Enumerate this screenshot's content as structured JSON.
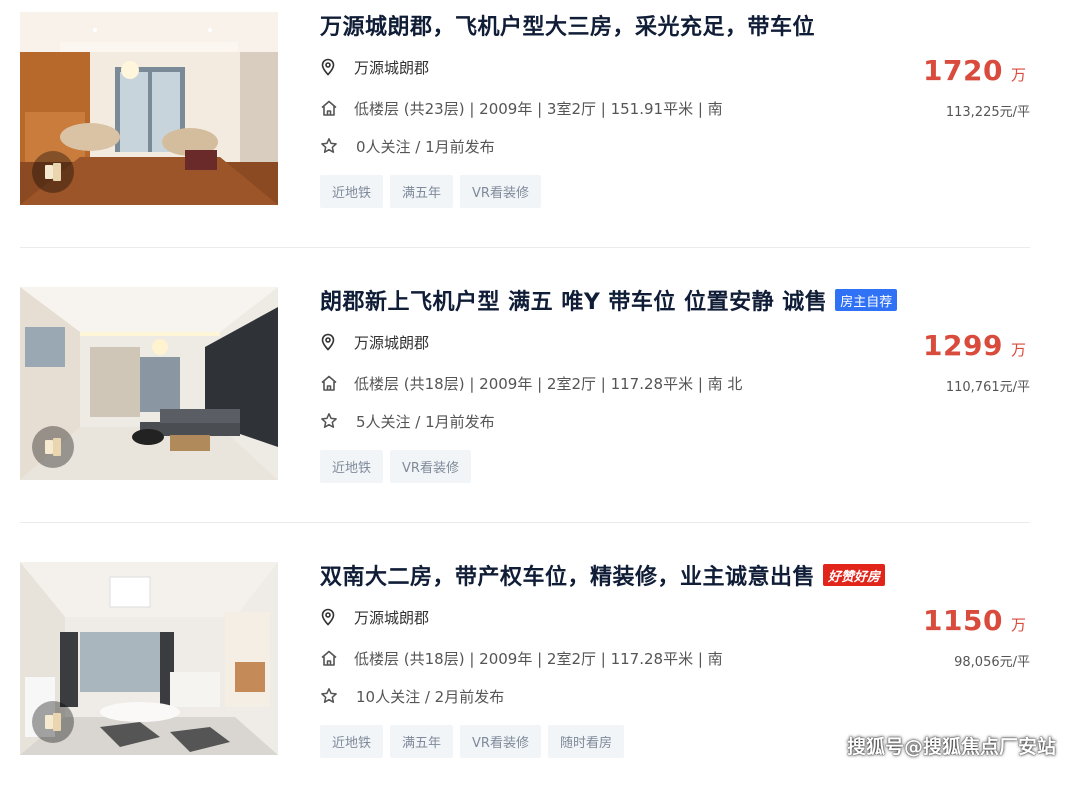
{
  "listings": [
    {
      "title": "万源城朗郡，飞机户型大三房，采光充足，带车位",
      "badge": "",
      "community": "万源城朗郡",
      "house_info": "低楼层 (共23层) | 2009年 | 3室2厅 | 151.91平米 | 南",
      "follow_info": "0人关注 / 1月前发布",
      "price": "1720",
      "price_unit": "万",
      "unit_price": "113,225元/平",
      "tags": [
        "近地铁",
        "满五年",
        "VR看装修"
      ]
    },
    {
      "title": "朗郡新上飞机户型 满五 唯Y 带车位 位置安静 诚售",
      "badge": "房主自荐",
      "community": "万源城朗郡",
      "house_info": "低楼层 (共18层) | 2009年 | 2室2厅 | 117.28平米 | 南 北",
      "follow_info": "5人关注 / 1月前发布",
      "price": "1299",
      "price_unit": "万",
      "unit_price": "110,761元/平",
      "tags": [
        "近地铁",
        "VR看装修"
      ]
    },
    {
      "title": "双南大二房，带产权车位，精装修，业主诚意出售",
      "badge": "好赞好房",
      "community": "万源城朗郡",
      "house_info": "低楼层 (共18层) | 2009年 | 2室2厅 | 117.28平米 | 南",
      "follow_info": "10人关注 / 2月前发布",
      "price": "1150",
      "price_unit": "万",
      "unit_price": "98,056元/平",
      "tags": [
        "近地铁",
        "满五年",
        "VR看装修",
        "随时看房"
      ]
    }
  ],
  "watermark": "搜狐号@搜狐焦点厂安站",
  "colors": {
    "price_red": "#d94b3c",
    "title_navy": "#101d37",
    "badge_blue": "#3072f6",
    "badge_red": "#e1251b",
    "tag_bg": "#f2f5f7"
  },
  "icons": [
    "location-pin-icon",
    "house-icon",
    "star-icon",
    "vr-icon"
  ]
}
